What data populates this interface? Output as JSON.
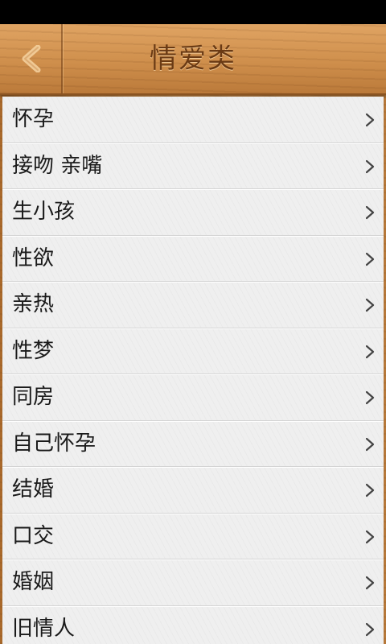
{
  "header": {
    "title": "情爱类",
    "back_icon": "chevron-left-icon"
  },
  "list": {
    "items": [
      {
        "label": "怀孕"
      },
      {
        "label": "接吻 亲嘴"
      },
      {
        "label": "生小孩"
      },
      {
        "label": "性欲"
      },
      {
        "label": "亲热"
      },
      {
        "label": "性梦"
      },
      {
        "label": "同房"
      },
      {
        "label": "自己怀孕"
      },
      {
        "label": "结婚"
      },
      {
        "label": "口交"
      },
      {
        "label": "婚姻"
      },
      {
        "label": "旧情人"
      }
    ],
    "item_icon": "chevron-right-icon"
  },
  "colors": {
    "wood": "#cf8f4c",
    "title_text": "#6a3a14",
    "list_bg": "#efefef"
  }
}
